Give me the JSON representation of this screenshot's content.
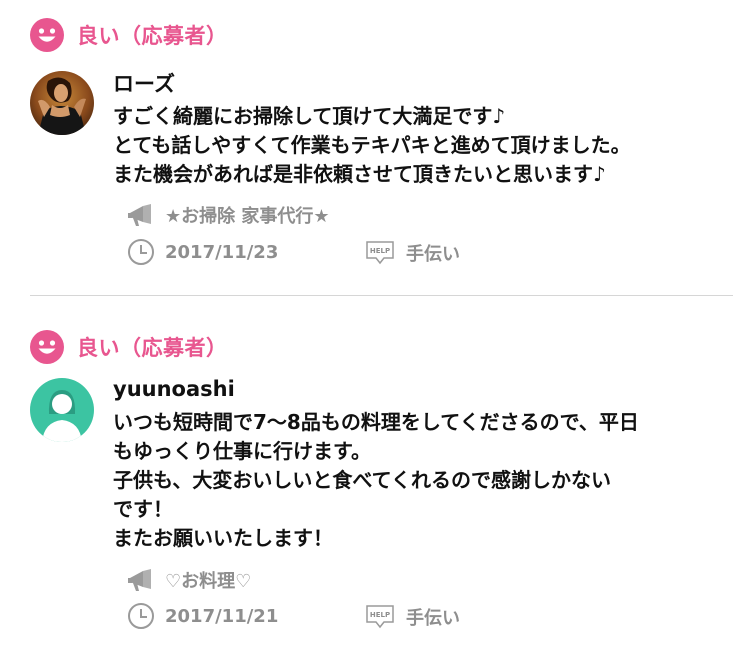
{
  "colors": {
    "accent": "#e8568f",
    "meta_gray": "#8e8e8e",
    "divider": "#d6d6d6",
    "avatar_teal": "#3cc4a2"
  },
  "reviews": [
    {
      "rating_label": "良い（応募者）",
      "rating_icon": "smile-icon",
      "reviewer_name": "ローズ",
      "comment_lines": [
        "すごく綺麗にお掃除して頂けて大満足です♪",
        "とても話しやすくて作業もテキパキと進めて頂けました。",
        "また機会があれば是非依頼させて頂きたいと思います♪"
      ],
      "job_title": "★お掃除 家事代行★",
      "job_icon": "megaphone-icon",
      "date": "2017/11/23",
      "date_icon": "clock-icon",
      "category": "手伝い",
      "category_badge": "HELP"
    },
    {
      "rating_label": "良い（応募者）",
      "rating_icon": "smile-icon",
      "reviewer_name": "yuunoashi",
      "comment_lines": [
        "いつも短時間で7〜8品もの料理をしてくださるので、平日",
        "もゆっくり仕事に行けます。",
        "子供も、大変おいしいと食べてくれるので感謝しかない",
        "です！",
        "またお願いいたします！"
      ],
      "job_title": "♡お料理♡",
      "job_icon": "megaphone-icon",
      "date": "2017/11/21",
      "date_icon": "clock-icon",
      "category": "手伝い",
      "category_badge": "HELP"
    }
  ]
}
